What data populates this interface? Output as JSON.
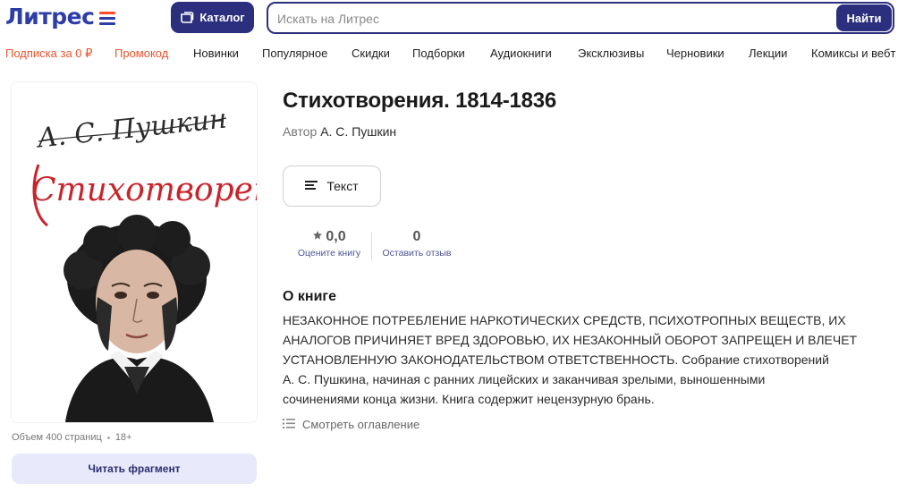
{
  "header": {
    "logo_text": "Литрес",
    "catalog_label": "Каталог",
    "search_placeholder": "Искать на Литрес",
    "search_button": "Найти"
  },
  "nav": {
    "items": [
      {
        "label": "Подписка за 0 ₽",
        "accent": true
      },
      {
        "label": "Промокод",
        "accent": true
      },
      {
        "label": "Новинки"
      },
      {
        "label": "Популярное"
      },
      {
        "label": "Скидки"
      },
      {
        "label": "Подборки"
      },
      {
        "label": "Аудиокниги"
      },
      {
        "label": "Эксклюзивы"
      },
      {
        "label": "Черновики"
      },
      {
        "label": "Лекции"
      },
      {
        "label": "Комиксы и вебт"
      }
    ]
  },
  "cover": {
    "signature": "А. С. Пушкин",
    "title_script": "Стихотворения"
  },
  "book": {
    "title": "Стихотворения. 1814-1836",
    "author_prefix": "Автор",
    "author": "А. С. Пушкин",
    "format_label": "Текст",
    "meta_pages": "Объем 400 страниц",
    "meta_age": "18+",
    "read_fragment_label": "Читать фрагмент"
  },
  "stats": {
    "rating_value": "0,0",
    "rating_label": "Оцените книгу",
    "reviews_value": "0",
    "reviews_label": "Оставить отзыв"
  },
  "about": {
    "heading": "О книге",
    "lines": [
      "НЕЗАКОННОЕ ПОТРЕБЛЕНИЕ НАРКОТИЧЕСКИХ СРЕДСТВ, ПСИХОТРОПНЫХ ВЕЩЕСТВ, ИХ",
      "АНАЛОГОВ ПРИЧИНЯЕТ ВРЕД ЗДОРОВЬЮ, ИХ НЕЗАКОННЫЙ ОБОРОТ ЗАПРЕЩЕН И ВЛЕЧЕТ",
      "УСТАНОВЛЕННУЮ ЗАКОНОДАТЕЛЬСТВОМ ОТВЕТСТВЕННОСТЬ. Собрание стихотворений",
      "А. С. Пушкина, начиная с ранних лицейских и заканчивая зрелыми, выношенными",
      "сочинениями конца жизни. Книга содержит нецензурную брань."
    ],
    "toc_label": "Смотреть оглавление"
  },
  "colors": {
    "brand_blue": "#2b2f7e",
    "brand_orange": "#e8542d",
    "link_blue": "#4d5396"
  },
  "icons": {
    "catalog": "book-icon",
    "format": "text-lines-icon",
    "rating": "star-icon",
    "toc": "list-icon"
  }
}
